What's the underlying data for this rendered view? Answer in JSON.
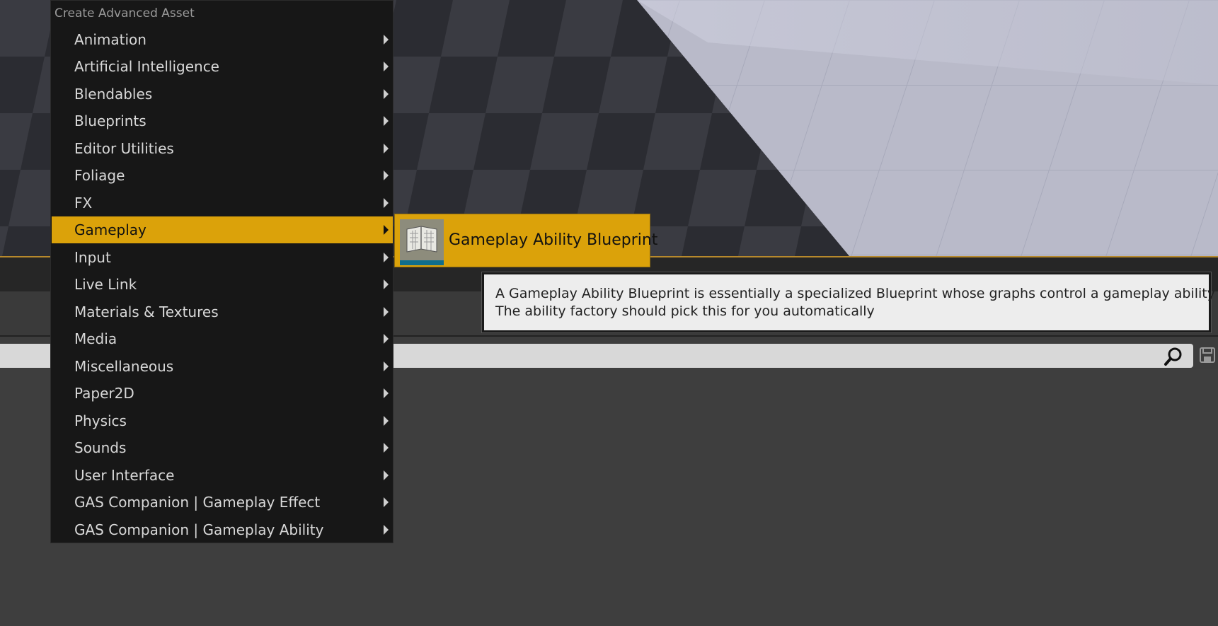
{
  "menu": {
    "heading": "Create Advanced Asset",
    "items": [
      {
        "label": "Animation"
      },
      {
        "label": "Artificial Intelligence"
      },
      {
        "label": "Blendables"
      },
      {
        "label": "Blueprints"
      },
      {
        "label": "Editor Utilities"
      },
      {
        "label": "Foliage"
      },
      {
        "label": "FX"
      },
      {
        "label": "Gameplay",
        "active": true
      },
      {
        "label": "Input"
      },
      {
        "label": "Live Link"
      },
      {
        "label": "Materials & Textures"
      },
      {
        "label": "Media"
      },
      {
        "label": "Miscellaneous"
      },
      {
        "label": "Paper2D"
      },
      {
        "label": "Physics"
      },
      {
        "label": "Sounds"
      },
      {
        "label": "User Interface"
      },
      {
        "label": "GAS Companion | Gameplay Effect"
      },
      {
        "label": "GAS Companion | Gameplay Ability"
      }
    ]
  },
  "submenu": {
    "item_label": "Gameplay Ability Blueprint",
    "icon": "blueprint-asset-icon"
  },
  "tooltip": {
    "line1": "A Gameplay Ability Blueprint is essentially a specialized Blueprint whose graphs control a gameplay ability",
    "line2": "The ability factory should pick this for you automatically"
  },
  "search": {
    "icon": "search-icon"
  },
  "toolbar": {
    "save_icon": "save-icon"
  },
  "colors": {
    "accent": "#dba20a",
    "menu_bg": "#171717",
    "panel_bg": "#3e3e3e"
  }
}
